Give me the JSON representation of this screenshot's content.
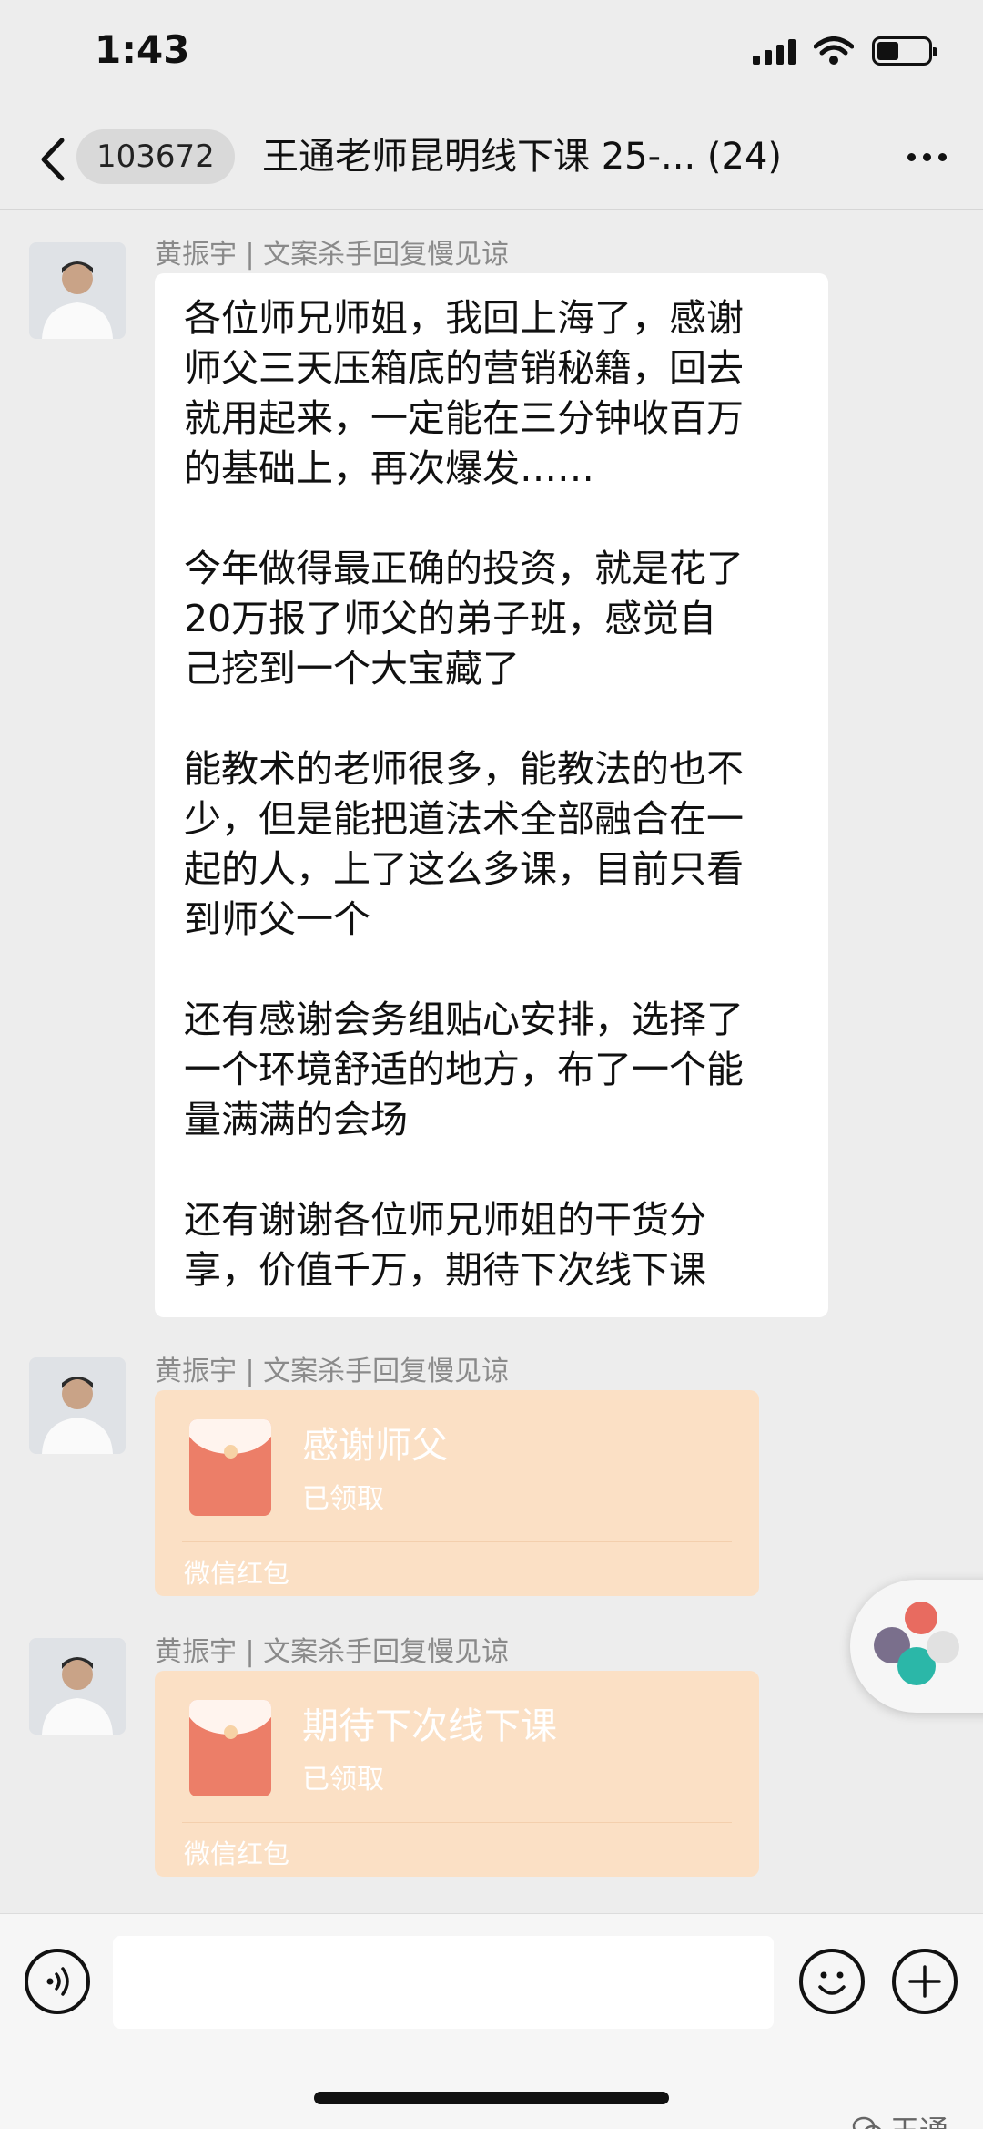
{
  "status_bar": {
    "time": "1:43",
    "battery_level": 0.42,
    "icons": [
      "signal-icon",
      "wifi-icon",
      "battery-icon"
    ]
  },
  "nav": {
    "unread_count": "103672",
    "title": "王通老师昆明线下课 25-... (24)",
    "icons": [
      "back-chevron-icon",
      "more-dots-icon"
    ]
  },
  "messages": [
    {
      "type": "text",
      "sender": "黄振宇 | 文案杀手回复慢见谅",
      "paragraphs": [
        "各位师兄师姐，我回上海了，感谢\n师父三天压箱底的营销秘籍，回去\n就用起来，一定能在三分钟收百万\n的基础上，再次爆发……",
        "今年做得最正确的投资，就是花了\n20万报了师父的弟子班，感觉自\n己挖到一个大宝藏了",
        "能教术的老师很多，能教法的也不\n少，但是能把道法术全部融合在一\n起的人，上了这么多课，目前只看\n到师父一个",
        "还有感谢会务组贴心安排，选择了\n一个环境舒适的地方，布了一个能\n量满满的会场",
        "还有谢谢各位师兄师姐的干货分\n享，价值千万，期待下次线下课"
      ]
    },
    {
      "type": "red_packet",
      "sender": "黄振宇 | 文案杀手回复慢见谅",
      "title": "感谢师父",
      "status": "已领取",
      "brand": "微信红包"
    },
    {
      "type": "red_packet",
      "sender": "黄振宇 | 文案杀手回复慢见谅",
      "title": "期待下次线下课",
      "status": "已领取",
      "brand": "微信红包"
    }
  ],
  "input_bar": {
    "placeholder": "",
    "icons": [
      "voice-icon",
      "emoji-icon",
      "plus-icon"
    ]
  },
  "watermark": "王通",
  "colors": {
    "background": "#ededed",
    "bubble": "#ffffff",
    "red_packet": "#fbe0c5",
    "envelope": "#ec7e68"
  }
}
